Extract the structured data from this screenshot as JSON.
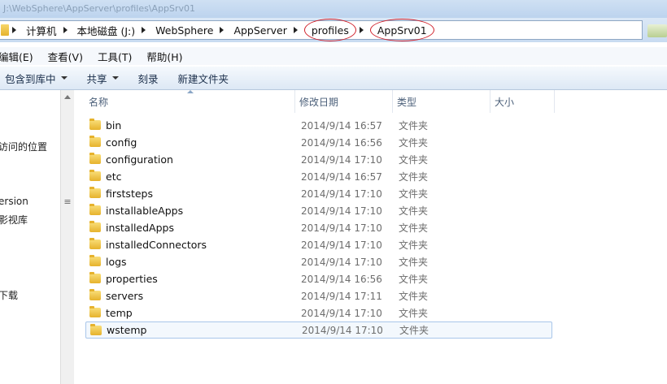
{
  "window": {
    "title": "J:\\WebSphere\\AppServer\\profiles\\AppSrv01"
  },
  "address": {
    "crumbs": [
      "计算机",
      "本地磁盘 (J:)",
      "WebSphere",
      "AppServer",
      "profiles",
      "AppSrv01"
    ]
  },
  "menu": [
    "编辑(E)",
    "查看(V)",
    "工具(T)",
    "帮助(H)"
  ],
  "toolbar": {
    "include_library": "包含到库中",
    "share": "共享",
    "burn": "刻录",
    "new_folder": "新建文件夹"
  },
  "nav": {
    "items": [
      "访问的位置",
      "ersion",
      "影视库",
      "下载"
    ]
  },
  "columns": {
    "name": "名称",
    "date": "修改日期",
    "type": "类型",
    "size": "大小"
  },
  "files": [
    {
      "name": "bin",
      "date": "2014/9/14 16:57",
      "type": "文件夹"
    },
    {
      "name": "config",
      "date": "2014/9/14 16:56",
      "type": "文件夹"
    },
    {
      "name": "configuration",
      "date": "2014/9/14 17:10",
      "type": "文件夹"
    },
    {
      "name": "etc",
      "date": "2014/9/14 16:57",
      "type": "文件夹"
    },
    {
      "name": "firststeps",
      "date": "2014/9/14 17:10",
      "type": "文件夹"
    },
    {
      "name": "installableApps",
      "date": "2014/9/14 17:10",
      "type": "文件夹"
    },
    {
      "name": "installedApps",
      "date": "2014/9/14 17:10",
      "type": "文件夹"
    },
    {
      "name": "installedConnectors",
      "date": "2014/9/14 17:10",
      "type": "文件夹"
    },
    {
      "name": "logs",
      "date": "2014/9/14 17:10",
      "type": "文件夹"
    },
    {
      "name": "properties",
      "date": "2014/9/14 16:56",
      "type": "文件夹"
    },
    {
      "name": "servers",
      "date": "2014/9/14 17:11",
      "type": "文件夹"
    },
    {
      "name": "temp",
      "date": "2014/9/14 17:10",
      "type": "文件夹"
    },
    {
      "name": "wstemp",
      "date": "2014/9/14 17:10",
      "type": "文件夹"
    }
  ],
  "selected_file": "wstemp",
  "colors": {
    "highlight_circle": "#d0202a",
    "folder": "#e6b22c",
    "selection": "#a9c6ea"
  }
}
